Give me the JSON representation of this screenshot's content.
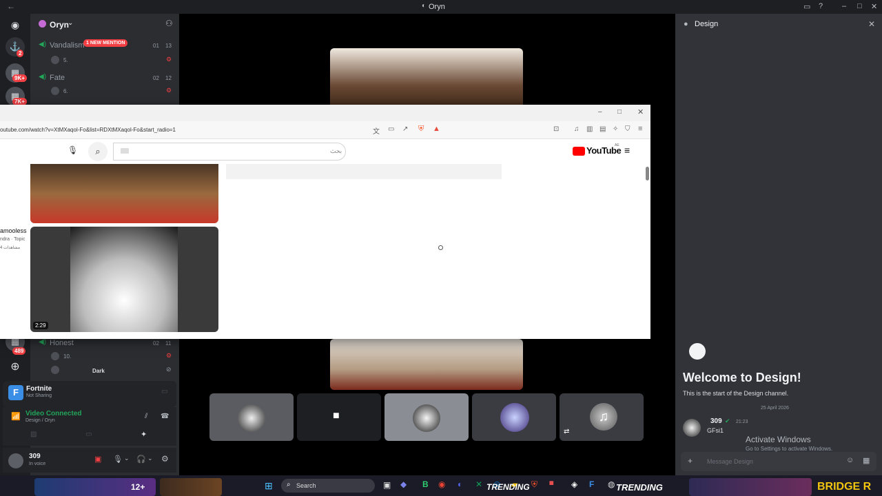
{
  "window": {
    "title": "Oryn"
  },
  "server": {
    "name": "Oryn"
  },
  "rail": {
    "badges": [
      "2",
      "9K+",
      "7K+",
      "489"
    ]
  },
  "channels": [
    {
      "name": "Vandalism",
      "mention": "1 NEW MENTION",
      "c1": "01",
      "c2": "13",
      "user": "5."
    },
    {
      "name": "Fate",
      "c1": "02",
      "c2": "12",
      "user": "6."
    },
    {
      "name": "Honest",
      "c1": "02",
      "c2": "11",
      "user": "10.",
      "user2": "Dark"
    }
  ],
  "activity": {
    "name": "Fortnite",
    "status": "Not Sharing"
  },
  "voice": {
    "status": "Video Connected",
    "location": "Design / Oryn"
  },
  "user": {
    "name": "309",
    "status": "In voice"
  },
  "right": {
    "title": "Design",
    "welcome": "Welcome to Design!",
    "welcome_sub": "This is the start of the Design channel.",
    "date": "25 April 2026",
    "msg_author": "309",
    "msg_time": "21:23",
    "msg_text": "GFsi1",
    "input_placeholder": "Message Design",
    "activate_title": "Activate Windows",
    "activate_sub": "Go to Settings to activate Windows."
  },
  "browser": {
    "url": "outube.com/watch?v=XtMXaqol-Fo&list=RDXtMXaqol-Fo&start_radio=1",
    "search_placeholder": "بحث",
    "logo": "YouTube",
    "logo_sup": "AE",
    "side_title": "amooless",
    "side_sub": "ndra · Topic",
    "side_views": "4 مشاهدات",
    "duration": "2:29"
  },
  "taskbar": {
    "search": "Search",
    "trending1": "TRENDING",
    "trending2": "TRENDING",
    "bridge": "BRIDGE R",
    "rating": "12+"
  },
  "colors": {
    "accent": "#5865f2",
    "green": "#23a55a",
    "red": "#f23f43",
    "yt_red": "#ff0000"
  }
}
